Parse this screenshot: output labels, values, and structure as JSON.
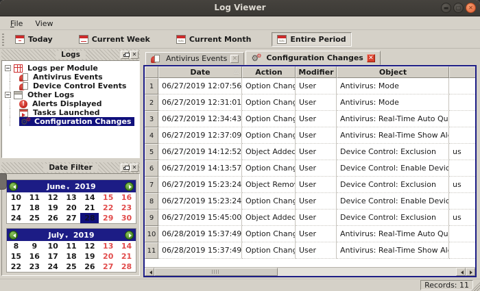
{
  "window": {
    "title": "Log Viewer",
    "controls": [
      "minimize",
      "maximize",
      "close"
    ]
  },
  "colors": {
    "titlebar_bg": "#3b3935",
    "accent_navy": "#1c1c85",
    "selection_navy": "#10107c",
    "icon_red": "#cc2a2a",
    "weekend_red": "#e14b4b",
    "nav_green": "#3f8f1f",
    "close_orange": "#ee7850"
  },
  "menubar": {
    "items": [
      {
        "label": "File",
        "underline_first": true
      },
      {
        "label": "View",
        "underline_first": false
      }
    ]
  },
  "toolbar": {
    "buttons": [
      {
        "label": "Today",
        "icon": "calendar-today-icon",
        "variant": "dot",
        "active": false
      },
      {
        "label": "Current Week",
        "icon": "calendar-week-icon",
        "variant": "lines",
        "active": false
      },
      {
        "label": "Current Month",
        "icon": "calendar-month-icon",
        "variant": "grid",
        "active": false
      },
      {
        "label": "Entire Period",
        "icon": "calendar-period-icon",
        "variant": "grid",
        "active": true
      }
    ]
  },
  "logs_panel": {
    "title": "Logs",
    "tree": [
      {
        "label": "Logs per Module",
        "level": 0,
        "icon": "module-logs",
        "expander": true,
        "selected": false
      },
      {
        "label": "Antivirus Events",
        "level": 1,
        "icon": "doc-red",
        "expander": false,
        "selected": false
      },
      {
        "label": "Device Control Events",
        "level": 1,
        "icon": "doc-red",
        "expander": false,
        "selected": false
      },
      {
        "label": "Other Logs",
        "level": 0,
        "icon": "other-logs",
        "expander": true,
        "selected": false
      },
      {
        "label": "Alerts Displayed",
        "level": 1,
        "icon": "alert",
        "expander": false,
        "selected": false
      },
      {
        "label": "Tasks Launched",
        "level": 1,
        "icon": "tasks",
        "expander": false,
        "selected": false
      },
      {
        "label": "Configuration Changes",
        "level": 1,
        "icon": "config",
        "expander": false,
        "selected": true
      }
    ]
  },
  "date_filter": {
    "title": "Date Filter",
    "calendars": [
      {
        "month": "June",
        "year": "2019",
        "weeks": [
          [
            {
              "d": "10"
            },
            {
              "d": "11"
            },
            {
              "d": "12"
            },
            {
              "d": "13"
            },
            {
              "d": "14"
            },
            {
              "d": "15",
              "red": true
            },
            {
              "d": "16",
              "red": true
            }
          ],
          [
            {
              "d": "17"
            },
            {
              "d": "18"
            },
            {
              "d": "19"
            },
            {
              "d": "20"
            },
            {
              "d": "21"
            },
            {
              "d": "22",
              "red": true
            },
            {
              "d": "23",
              "red": true
            }
          ],
          [
            {
              "d": "24"
            },
            {
              "d": "25"
            },
            {
              "d": "26"
            },
            {
              "d": "27",
              "bold": true
            },
            {
              "d": "28",
              "selected": true
            },
            {
              "d": "29",
              "red": true
            },
            {
              "d": "30",
              "red": true
            }
          ]
        ]
      },
      {
        "month": "July",
        "year": "2019",
        "weeks": [
          [
            {
              "d": "8"
            },
            {
              "d": "9"
            },
            {
              "d": "10"
            },
            {
              "d": "11"
            },
            {
              "d": "12"
            },
            {
              "d": "13",
              "red": true
            },
            {
              "d": "14",
              "red": true
            }
          ],
          [
            {
              "d": "15"
            },
            {
              "d": "16"
            },
            {
              "d": "17"
            },
            {
              "d": "18"
            },
            {
              "d": "19"
            },
            {
              "d": "20",
              "red": true
            },
            {
              "d": "21",
              "red": true
            }
          ],
          [
            {
              "d": "22"
            },
            {
              "d": "23"
            },
            {
              "d": "24"
            },
            {
              "d": "25"
            },
            {
              "d": "26"
            },
            {
              "d": "27",
              "red": true
            },
            {
              "d": "28",
              "red": true
            }
          ]
        ]
      }
    ]
  },
  "tabs": [
    {
      "label": "Antivirus Events",
      "icon": "antivirus-events-icon",
      "active": false
    },
    {
      "label": "Configuration Changes",
      "icon": "configuration-changes-icon",
      "active": true
    }
  ],
  "table": {
    "columns": [
      "",
      "Date",
      "Action",
      "Modifier",
      "Object",
      ""
    ],
    "sort_column": "Date",
    "rows": [
      [
        "1",
        "06/27/2019 12:07:56",
        "Option Changed",
        "User",
        "Antivirus: Mode",
        ""
      ],
      [
        "2",
        "06/27/2019 12:31:01",
        "Option Changed",
        "User",
        "Antivirus: Mode",
        ""
      ],
      [
        "3",
        "06/27/2019 12:34:43",
        "Option Changed",
        "User",
        "Antivirus: Real-Time Auto Quarantine",
        ""
      ],
      [
        "4",
        "06/27/2019 12:37:09",
        "Option Changed",
        "User",
        "Antivirus: Real-Time Show Alerts",
        ""
      ],
      [
        "5",
        "06/27/2019 14:12:52",
        "Object Added",
        "User",
        "Device Control: Exclusion",
        "us"
      ],
      [
        "6",
        "06/27/2019 14:13:57",
        "Option Changed",
        "User",
        "Device Control: Enable Device Con...",
        ""
      ],
      [
        "7",
        "06/27/2019 15:23:24",
        "Object Removed",
        "User",
        "Device Control: Exclusion",
        "us"
      ],
      [
        "8",
        "06/27/2019 15:23:24",
        "Option Changed",
        "User",
        "Device Control: Enable Device Con...",
        ""
      ],
      [
        "9",
        "06/27/2019 15:45:00",
        "Object Added",
        "User",
        "Device Control: Exclusion",
        "us"
      ],
      [
        "10",
        "06/28/2019 15:37:49",
        "Option Changed",
        "User",
        "Antivirus: Real-Time Auto Quarantine",
        ""
      ],
      [
        "11",
        "06/28/2019 15:37:49",
        "Option Changed",
        "User",
        "Antivirus: Real-Time Show Alerts",
        ""
      ]
    ]
  },
  "statusbar": {
    "records": "Records: 11"
  }
}
